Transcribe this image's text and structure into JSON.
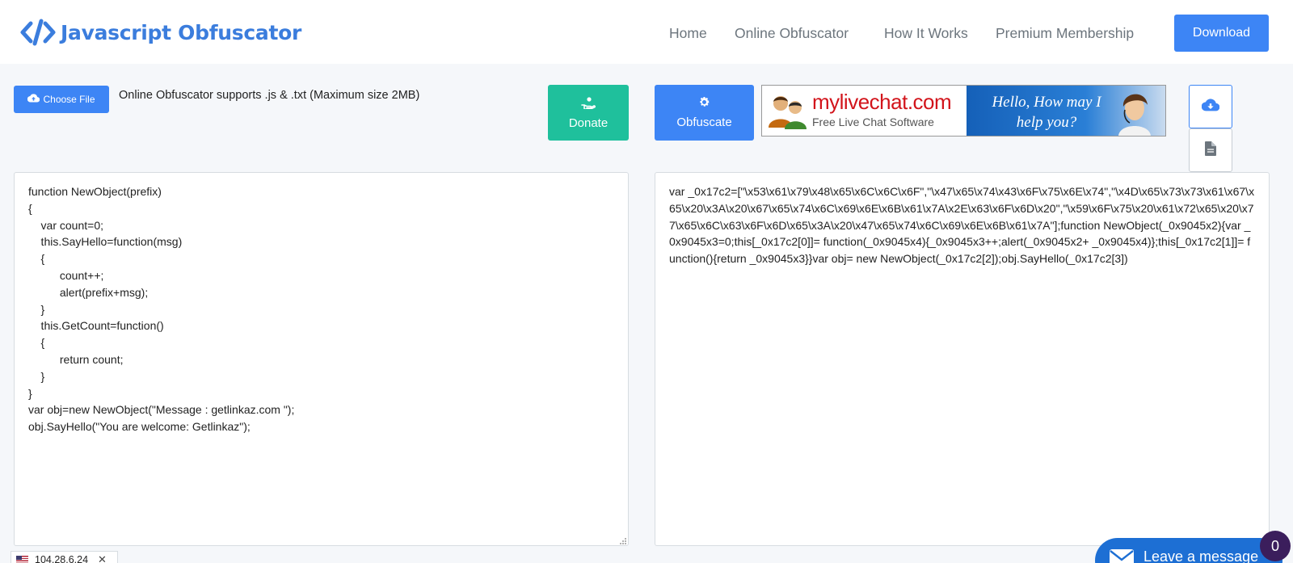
{
  "header": {
    "brand": "Javascript Obfuscator",
    "nav": [
      "Home",
      "Online Obfuscator",
      "How It Works",
      "Premium Membership"
    ],
    "download_label": "Download"
  },
  "toolbar": {
    "choose_file_label": "Choose File",
    "supports_text": "Online Obfuscator supports .js & .txt (Maximum size 2MB)",
    "donate_label": "Donate",
    "obfuscate_label": "Obfuscate"
  },
  "ad": {
    "brand": "mylivechat.com",
    "tagline": "Free Live Chat Software",
    "greeting_line1": "Hello, How may I",
    "greeting_line2": "help you?"
  },
  "input_code": "function NewObject(prefix)\n{\n    var count=0;\n    this.SayHello=function(msg)\n    {\n          count++;\n          alert(prefix+msg);\n    }\n    this.GetCount=function()\n    {\n          return count;\n    }\n}\nvar obj=new NewObject(\"Message : getlinkaz.com \");\nobj.SayHello(\"You are welcome: Getlinkaz\");",
  "output_code": "var _0x17c2=[\"\\x53\\x61\\x79\\x48\\x65\\x6C\\x6C\\x6F\",\"\\x47\\x65\\x74\\x43\\x6F\\x75\\x6E\\x74\",\"\\x4D\\x65\\x73\\x73\\x61\\x67\\x65\\x20\\x3A\\x20\\x67\\x65\\x74\\x6C\\x69\\x6E\\x6B\\x61\\x7A\\x2E\\x63\\x6F\\x6D\\x20\",\"\\x59\\x6F\\x75\\x20\\x61\\x72\\x65\\x20\\x77\\x65\\x6C\\x63\\x6F\\x6D\\x65\\x3A\\x20\\x47\\x65\\x74\\x6C\\x69\\x6E\\x6B\\x61\\x7A\"];function NewObject(_0x9045x2){var _0x9045x3=0;this[_0x17c2[0]]= function(_0x9045x4){_0x9045x3++;alert(_0x9045x2+ _0x9045x4)};this[_0x17c2[1]]= function(){return _0x9045x3}}var obj= new NewObject(_0x17c2[2]);obj.SayHello(_0x17c2[3])",
  "ip_badge": "104.28.6.24",
  "chat": {
    "label": "Leave a message",
    "count": "0"
  },
  "colors": {
    "brand_blue": "#3b7ddd",
    "button_blue": "#3d85f5",
    "donate_green": "#1fc09c",
    "chat_blue": "#1d6fd4",
    "badge_purple": "#3b1e5c"
  },
  "icons": [
    "code-logo-icon",
    "cloud-upload-icon",
    "donate-hand-icon",
    "gear-icon",
    "cloud-download-icon",
    "file-icon",
    "envelope-icon",
    "close-icon"
  ]
}
